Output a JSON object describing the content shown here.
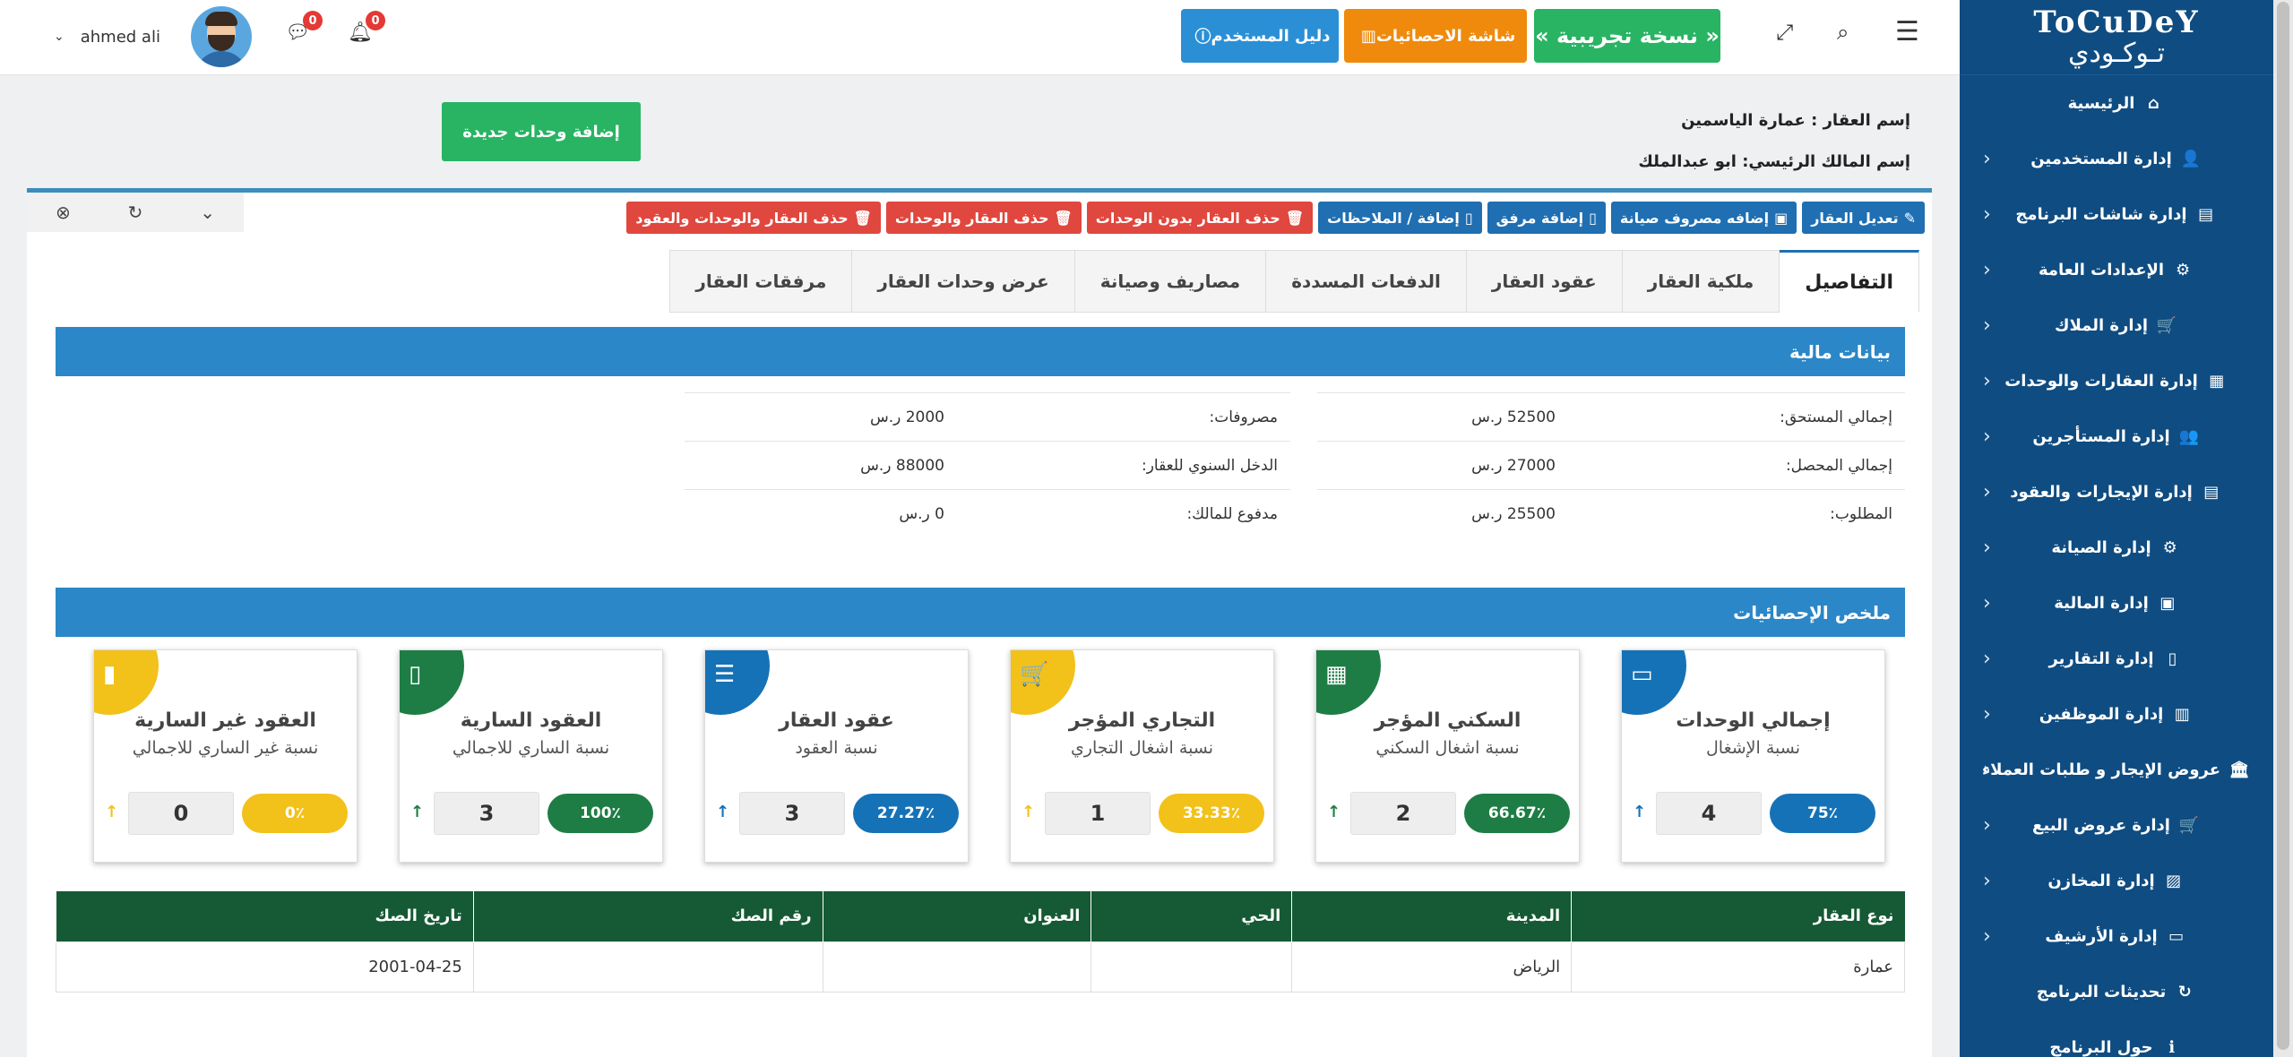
{
  "sidebar": {
    "logo_latin": "ToCuDeY",
    "logo_arabic": "تـوكـودي",
    "items": [
      {
        "label": "الرئيسية",
        "icon": "home-icon",
        "glyph": "⌂",
        "chevron": false
      },
      {
        "label": "إدارة المستخدمين",
        "icon": "users-icon",
        "glyph": "👤",
        "chevron": true
      },
      {
        "label": "إدارة شاشات البرنامج",
        "icon": "file-icon",
        "glyph": "▤",
        "chevron": true
      },
      {
        "label": "الإعدادات العامة",
        "icon": "gear-icon",
        "glyph": "⚙",
        "chevron": true
      },
      {
        "label": "إدارة الملاك",
        "icon": "cart-icon",
        "glyph": "🛒",
        "chevron": true
      },
      {
        "label": "إدارة العقارات والوحدات",
        "icon": "building-icon",
        "glyph": "▦",
        "chevron": true
      },
      {
        "label": "إدارة المستأجرين",
        "icon": "users-icon",
        "glyph": "👥",
        "chevron": true
      },
      {
        "label": "إدارة الإيجارات والعقود",
        "icon": "file-icon",
        "glyph": "▤",
        "chevron": true
      },
      {
        "label": "إدارة الصيانة",
        "icon": "cogs-icon",
        "glyph": "⚙",
        "chevron": true
      },
      {
        "label": "إدارة المالية",
        "icon": "money-icon",
        "glyph": "▣",
        "chevron": true
      },
      {
        "label": "إدارة التقارير",
        "icon": "file-icon",
        "glyph": "▯",
        "chevron": true
      },
      {
        "label": "إدارة الموظفين",
        "icon": "briefcase-icon",
        "glyph": "▥",
        "chevron": true
      },
      {
        "label": "عروض الإيجار و طلبات العملاء",
        "icon": "bank-icon",
        "glyph": "🏛",
        "chevron": true
      },
      {
        "label": "إدارة عروض البيع",
        "icon": "cart-icon",
        "glyph": "🛒",
        "chevron": true
      },
      {
        "label": "إدارة المخازن",
        "icon": "basket-icon",
        "glyph": "▨",
        "chevron": true
      },
      {
        "label": "إدارة الأرشيف",
        "icon": "archive-icon",
        "glyph": "▭",
        "chevron": true
      },
      {
        "label": "تحديثات البرنامج",
        "icon": "refresh-icon",
        "glyph": "↻",
        "chevron": false
      },
      {
        "label": "حول البرنامج",
        "icon": "info-icon",
        "glyph": "ℹ",
        "chevron": false
      }
    ]
  },
  "topbar": {
    "trial_label": "« نسخة تجريبية »",
    "stats_label": "شاشة الاحصائيات",
    "guide_label": "دليل المستخدم",
    "user_name": "ahmed ali",
    "notif_count": "0",
    "msg_count": "0",
    "colors": {
      "trial": "#28b463",
      "stats": "#f08a0c",
      "guide": "#2b8fd6"
    }
  },
  "property": {
    "name_line": "إسم العقار : عمارة الياسمين",
    "owner_line": "إسم المالك الرئيسي: ابو عبدالملك",
    "add_units_label": "إضافة وحدات جديدة"
  },
  "actions": [
    {
      "label": "تعديل العقار",
      "color": "blue",
      "glyph": "✎"
    },
    {
      "label": "إضافه مصروف صيانة",
      "color": "blue",
      "glyph": "▣"
    },
    {
      "label": "إضافة مرفق",
      "color": "blue",
      "glyph": "▯"
    },
    {
      "label": "إضافة / الملاحظات",
      "color": "blue",
      "glyph": "▯"
    },
    {
      "label": "حذف العقار بدون الوحدات",
      "color": "red",
      "glyph": "🗑"
    },
    {
      "label": "حذف العقار والوحدات",
      "color": "red",
      "glyph": "🗑"
    },
    {
      "label": "حذف العقار والوحدات والعقود",
      "color": "red",
      "glyph": "🗑"
    }
  ],
  "tabs": [
    "التفاصيل",
    "ملكية العقار",
    "عقود العقار",
    "الدفعات المسددة",
    "مصاريف وصيانة",
    "عرض وحدات العقار",
    "مرفقات العقار"
  ],
  "financial": {
    "title": "بيانات مالية",
    "right": [
      {
        "label": "إجمالي المستحق:",
        "value": "52500 ر.س"
      },
      {
        "label": "إجمالي المحصل:",
        "value": "27000 ر.س"
      },
      {
        "label": "المطلوب:",
        "value": "25500 ر.س"
      }
    ],
    "left": [
      {
        "label": "مصروفات:",
        "value": "2000 ر.س"
      },
      {
        "label": "الدخل السنوي للعقار:",
        "value": "88000 ر.س"
      },
      {
        "label": "مدفوع للمالك:",
        "value": "0 ر.س"
      }
    ]
  },
  "stats": {
    "title": "ملخص الإحصائيات",
    "cards": [
      {
        "title": "إجمالي الوحدات",
        "sub": "نسبة الإشغال",
        "pct": "75٪",
        "count": "4",
        "color": "#1572b6",
        "icon": "presentation-icon",
        "glyph": "▭"
      },
      {
        "title": "السكني المؤجر",
        "sub": "نسبة اشغال السكني",
        "pct": "66.67٪",
        "count": "2",
        "color": "#1e7d45",
        "icon": "building-icon",
        "glyph": "▦"
      },
      {
        "title": "التجاري المؤجر",
        "sub": "نسبة اشغال التجاري",
        "pct": "33.33٪",
        "count": "1",
        "color": "#f2c11a",
        "icon": "cart-icon",
        "glyph": "🛒"
      },
      {
        "title": "عقود العقار",
        "sub": "نسبة العقود",
        "pct": "27.27٪",
        "count": "3",
        "color": "#1572b6",
        "icon": "list-icon",
        "glyph": "☰"
      },
      {
        "title": "العقود السارية",
        "sub": "نسبة الساري للاجمالي",
        "pct": "100٪",
        "count": "3",
        "color": "#1e7d45",
        "icon": "file-icon",
        "glyph": "▯"
      },
      {
        "title": "العقود غير السارية",
        "sub": "نسبة غير الساري للاجمالي",
        "pct": "0٪",
        "count": "0",
        "color": "#f2c11a",
        "icon": "file-icon",
        "glyph": "▮"
      }
    ]
  },
  "table": {
    "headers": [
      "نوع العقار",
      "المدينة",
      "الحي",
      "العنوان",
      "رقم الصك",
      "تاريخ الصك"
    ],
    "rows": [
      [
        "عمارة",
        "الرياض",
        "",
        "",
        "",
        "2001-04-25"
      ]
    ]
  }
}
